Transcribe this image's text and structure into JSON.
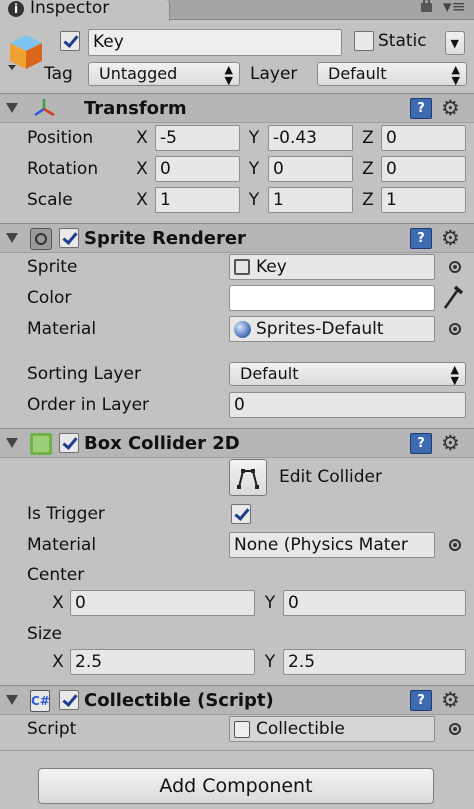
{
  "tab": {
    "title": "Inspector"
  },
  "gameobject": {
    "active": true,
    "name": "Key",
    "static_label": "Static",
    "static_checked": false,
    "tag_label": "Tag",
    "tag_value": "Untagged",
    "layer_label": "Layer",
    "layer_value": "Default"
  },
  "transform": {
    "title": "Transform",
    "position_label": "Position",
    "rotation_label": "Rotation",
    "scale_label": "Scale",
    "axis_x": "X",
    "axis_y": "Y",
    "axis_z": "Z",
    "position": {
      "x": "-5",
      "y": "-0.43",
      "z": "0"
    },
    "rotation": {
      "x": "0",
      "y": "0",
      "z": "0"
    },
    "scale": {
      "x": "1",
      "y": "1",
      "z": "1"
    }
  },
  "sprite_renderer": {
    "title": "Sprite Renderer",
    "enabled": true,
    "sprite_label": "Sprite",
    "sprite_value": "Key",
    "color_label": "Color",
    "color_value": "#ffffff",
    "material_label": "Material",
    "material_value": "Sprites-Default",
    "sorting_layer_label": "Sorting Layer",
    "sorting_layer_value": "Default",
    "order_label": "Order in Layer",
    "order_value": "0"
  },
  "box_collider": {
    "title": "Box Collider 2D",
    "enabled": true,
    "edit_collider_label": "Edit Collider",
    "is_trigger_label": "Is Trigger",
    "is_trigger": true,
    "material_label": "Material",
    "material_value": "None (Physics Mater",
    "center_label": "Center",
    "center": {
      "x": "0",
      "y": "0"
    },
    "size_label": "Size",
    "size": {
      "x": "2.5",
      "y": "2.5"
    },
    "axis_x": "X",
    "axis_y": "Y"
  },
  "collectible": {
    "title": "Collectible (Script)",
    "enabled": true,
    "script_label": "Script",
    "script_value": "Collectible"
  },
  "add_component_label": "Add Component",
  "colors": {
    "header_bg": "#b6b6b6",
    "panel_bg": "#c2c2c2",
    "help_icon": "#3d6ab0",
    "checkmark": "#1e3d8f"
  }
}
